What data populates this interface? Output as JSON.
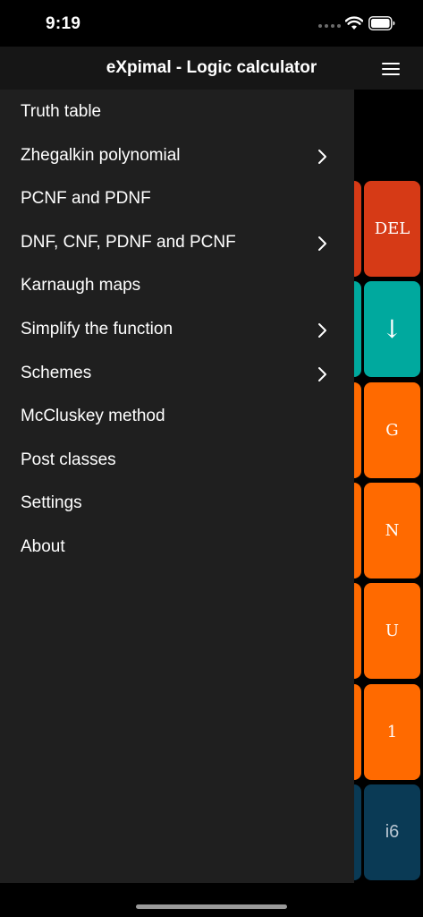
{
  "status_bar": {
    "time": "9:19"
  },
  "nav": {
    "title": "eXpimal - Logic calculator"
  },
  "menu": {
    "items": [
      {
        "label": "Truth table",
        "has_submenu": false
      },
      {
        "label": "Zhegalkin polynomial",
        "has_submenu": true
      },
      {
        "label": "PCNF and PDNF",
        "has_submenu": false
      },
      {
        "label": "DNF, CNF, PDNF and PCNF",
        "has_submenu": true
      },
      {
        "label": "Karnaugh maps",
        "has_submenu": false
      },
      {
        "label": "Simplify the function",
        "has_submenu": true
      },
      {
        "label": "Schemes",
        "has_submenu": true
      },
      {
        "label": "McCluskey method",
        "has_submenu": false
      },
      {
        "label": "Post classes",
        "has_submenu": false
      },
      {
        "label": "Settings",
        "has_submenu": false
      },
      {
        "label": "About",
        "has_submenu": false
      }
    ]
  },
  "keypad": {
    "keys": [
      {
        "label": "DEL",
        "color": "#d63a16"
      },
      {
        "label": "↓",
        "color": "#00a99e"
      },
      {
        "label": "G",
        "color": "#ff6a00"
      },
      {
        "label": "N",
        "color": "#ff6a00"
      },
      {
        "label": "U",
        "color": "#ff6a00"
      },
      {
        "label": "1",
        "color": "#ff6a00"
      },
      {
        "label": "i6",
        "color": "#0a3a55"
      }
    ]
  },
  "colors": {
    "background": "#000000",
    "nav_bar": "#161616",
    "drawer": "#1f1f1f",
    "text": "#ffffff",
    "home_indicator": "#9a9a9a"
  }
}
